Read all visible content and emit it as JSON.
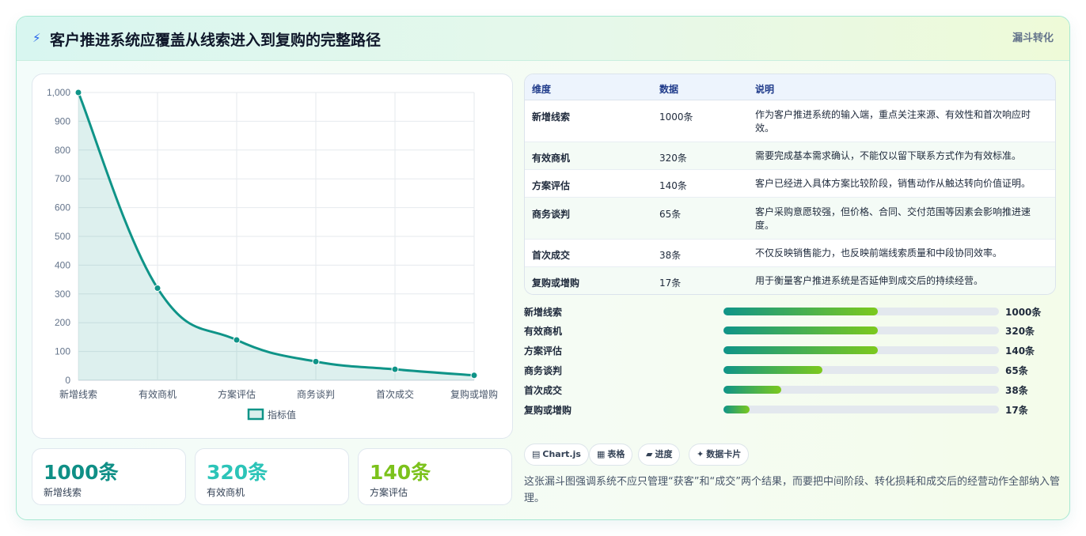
{
  "header": {
    "title": "客户推进系统应覆盖从线索进入到复购的完整路径",
    "tag": "漏斗转化"
  },
  "chart_data": {
    "type": "line",
    "categories": [
      "新增线索",
      "有效商机",
      "方案评估",
      "商务谈判",
      "首次成交",
      "复购或增购"
    ],
    "series": [
      {
        "name": "指标值",
        "values": [
          1000,
          320,
          140,
          65,
          38,
          17
        ]
      }
    ],
    "ylim": [
      0,
      1000
    ],
    "yticks": [
      "0",
      "100",
      "200",
      "300",
      "400",
      "500",
      "600",
      "700",
      "800",
      "900",
      "1,000"
    ],
    "ytick_values": [
      0,
      100,
      200,
      300,
      400,
      500,
      600,
      700,
      800,
      900,
      1000
    ],
    "grid": true,
    "legend": "bottom",
    "fill": true,
    "color": "#0f9488"
  },
  "kpis": [
    {
      "value": "1000条",
      "label": "新增线索",
      "color": "#0f8f86"
    },
    {
      "value": "320条",
      "label": "有效商机",
      "color": "#2cc4b8"
    },
    {
      "value": "140条",
      "label": "方案评估",
      "color": "#7cc21c"
    }
  ],
  "table": {
    "headers": [
      "维度",
      "数据",
      "说明"
    ],
    "rows": [
      {
        "dim": "新增线索",
        "data": "1000条",
        "desc": "作为客户推进系统的输入端，重点关注来源、有效性和首次响应时效。"
      },
      {
        "dim": "有效商机",
        "data": "320条",
        "desc": "需要完成基本需求确认，不能仅以留下联系方式作为有效标准。"
      },
      {
        "dim": "方案评估",
        "data": "140条",
        "desc": "客户已经进入具体方案比较阶段，销售动作从触达转向价值证明。"
      },
      {
        "dim": "商务谈判",
        "data": "65条",
        "desc": "客户采购意愿较强，但价格、合同、交付范围等因素会影响推进速度。"
      },
      {
        "dim": "首次成交",
        "data": "38条",
        "desc": "不仅反映销售能力，也反映前端线索质量和中段协同效率。"
      },
      {
        "dim": "复购或增购",
        "data": "17条",
        "desc": "用于衡量客户推进系统是否延伸到成交后的持续经营。"
      }
    ]
  },
  "progress": [
    {
      "label": "新增线索",
      "value": "1000条",
      "fraction": 0.56
    },
    {
      "label": "有效商机",
      "value": "320条",
      "fraction": 0.56
    },
    {
      "label": "方案评估",
      "value": "140条",
      "fraction": 0.56
    },
    {
      "label": "商务谈判",
      "value": "65条",
      "fraction": 0.36
    },
    {
      "label": "首次成交",
      "value": "38条",
      "fraction": 0.21
    },
    {
      "label": "复购或增购",
      "value": "17条",
      "fraction": 0.095
    }
  ],
  "chips": [
    {
      "icon": "▤",
      "icon_name": "chart-icon",
      "label": "Chart.js"
    },
    {
      "icon": "▦",
      "icon_name": "table-icon",
      "label": "表格"
    },
    {
      "icon": "▰",
      "icon_name": "progress-icon",
      "label": "进度"
    },
    {
      "icon": "✦",
      "icon_name": "sparkle-icon",
      "label": "数据卡片"
    }
  ],
  "note": "这张漏斗图强调系统不应只管理“获客”和“成交”两个结果，而要把中间阶段、转化损耗和成交后的经营动作全部纳入管理。"
}
